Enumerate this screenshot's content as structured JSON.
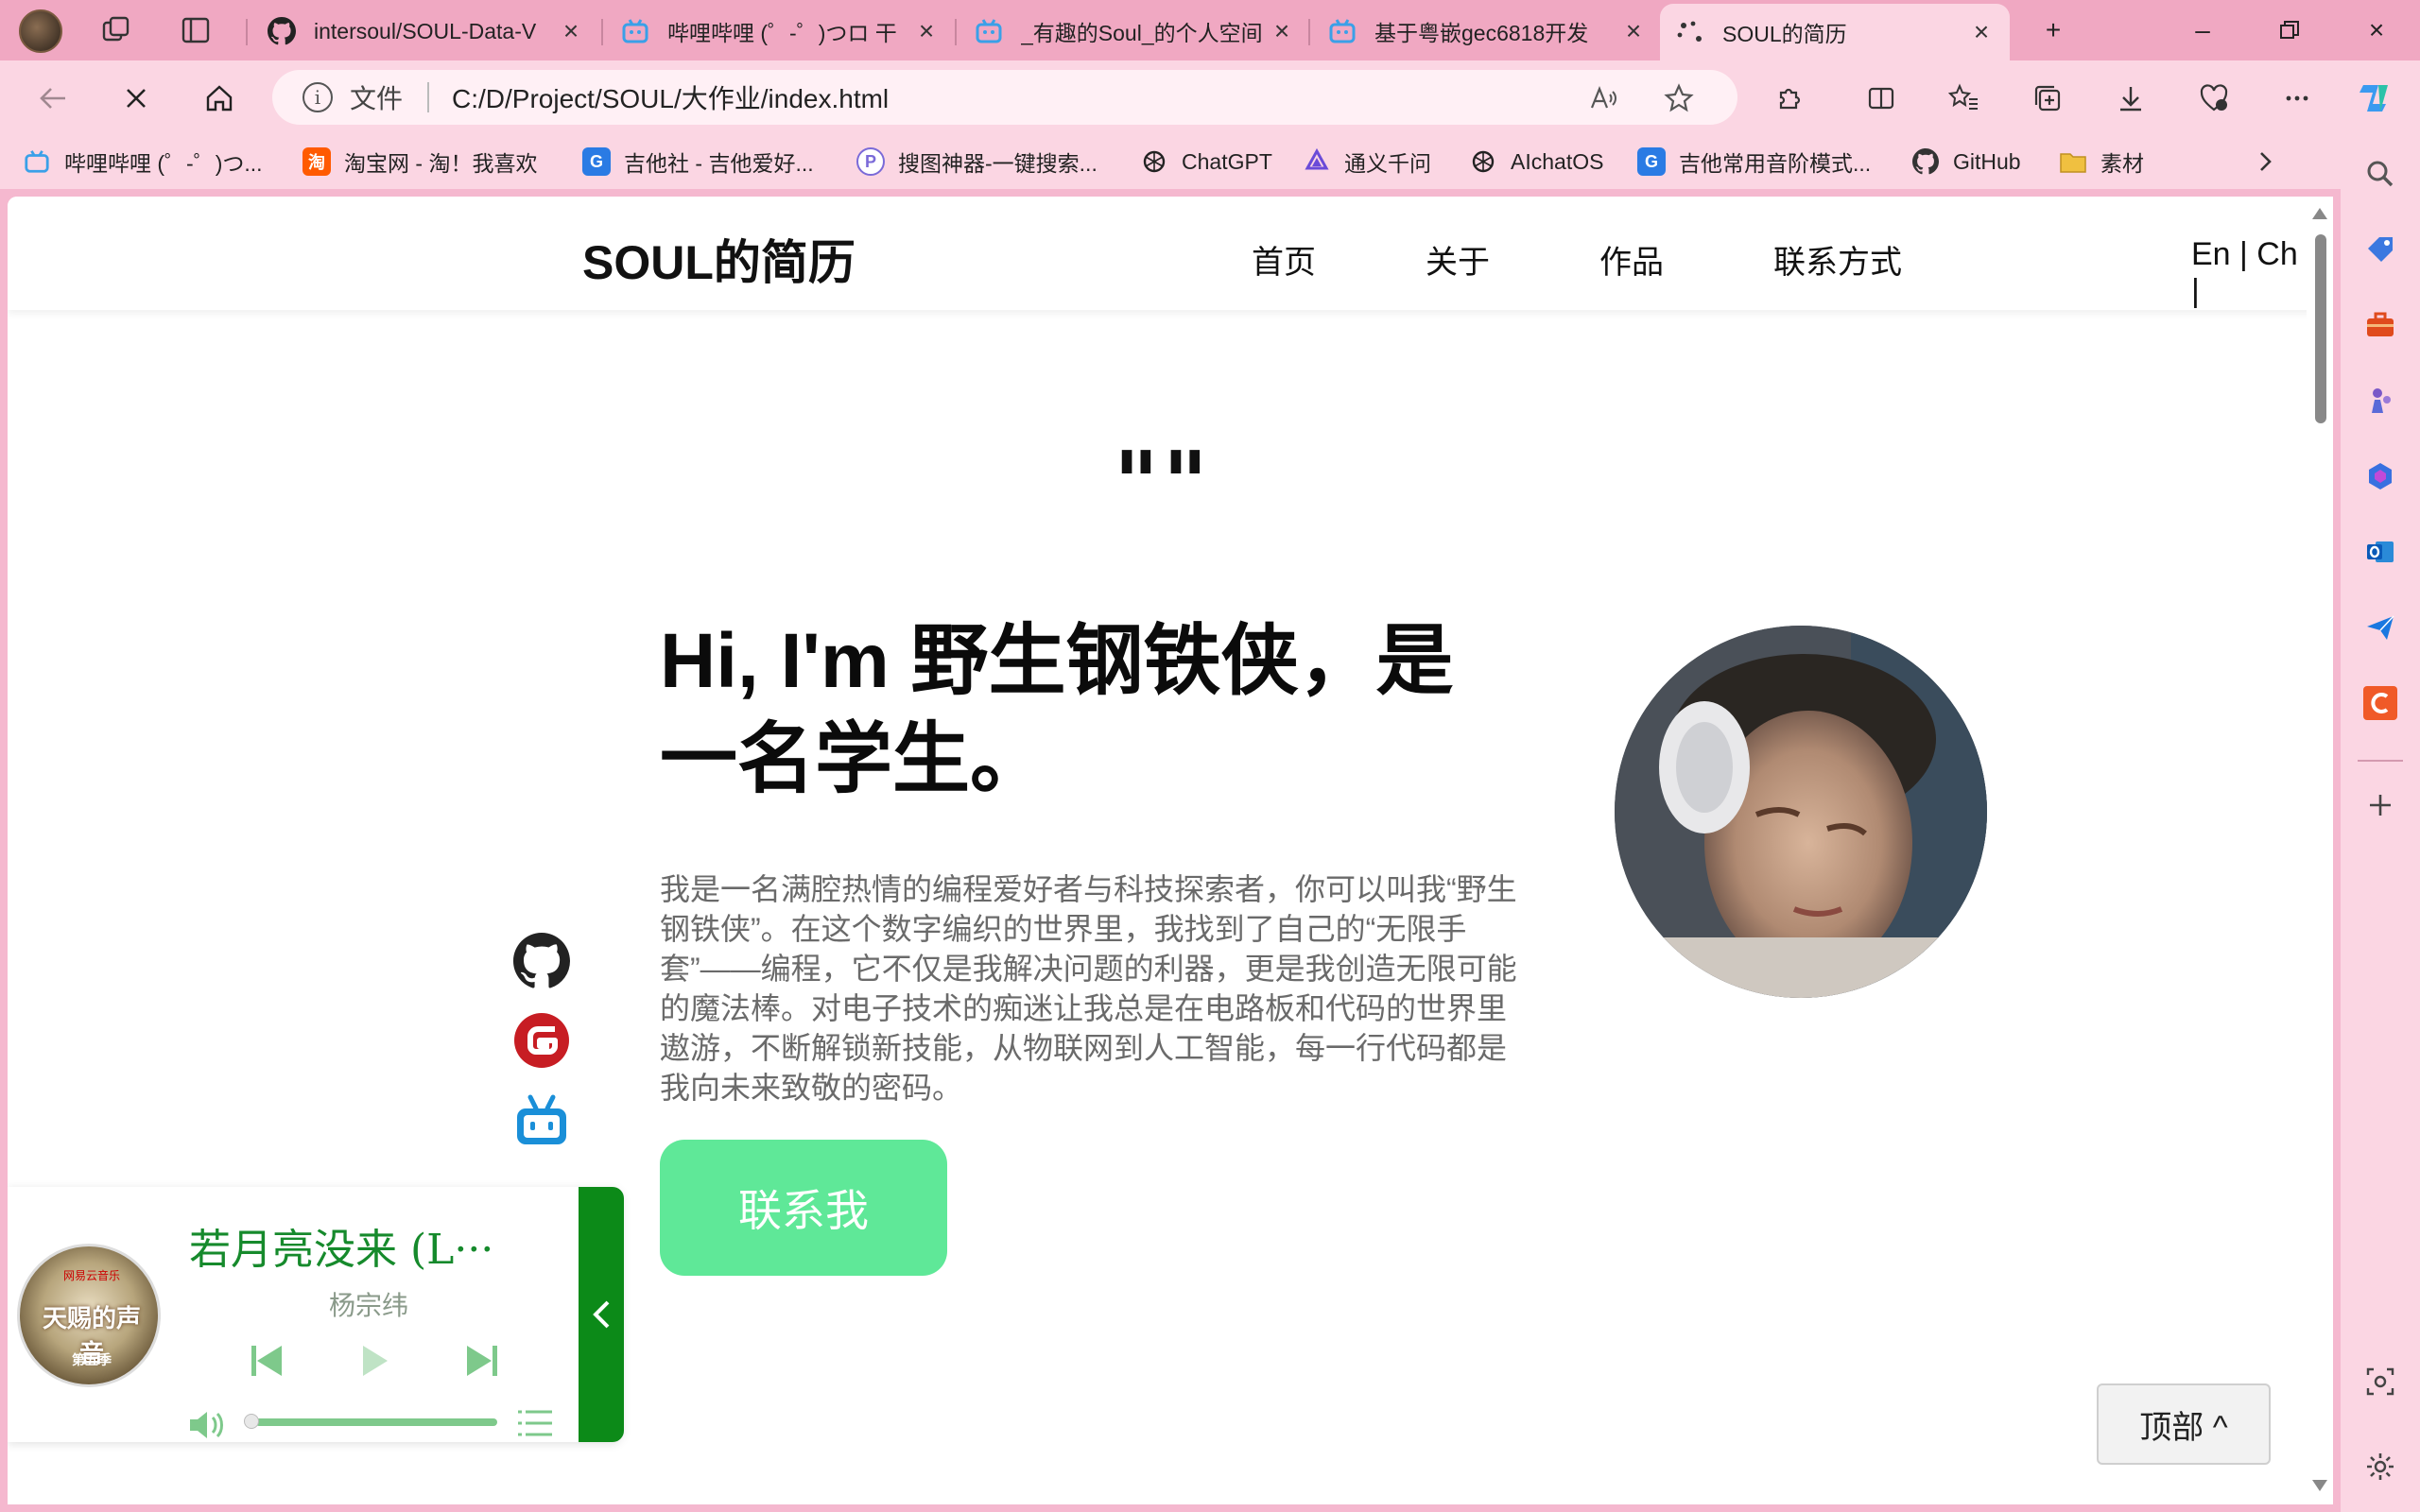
{
  "browser": {
    "tabs": [
      {
        "title": "intersoul/SOUL-Data-V",
        "icon": "github-icon"
      },
      {
        "title": "哔哩哔哩 (゜-゜)つロ 干",
        "icon": "bilibili-icon"
      },
      {
        "title": "_有趣的Soul_的个人空间",
        "icon": "bilibili-icon"
      },
      {
        "title": "基于粤嵌gec6818开发",
        "icon": "bilibili-icon"
      },
      {
        "title": "SOUL的简历",
        "icon": "loading-icon",
        "active": true
      }
    ],
    "address": {
      "scheme_label": "文件",
      "url": "C:/D/Project/SOUL/大作业/index.html"
    },
    "bookmarks": [
      {
        "label": "哔哩哔哩 (゜-゜)つ...",
        "icon": "bilibili-icon",
        "color": "#3aa0e8"
      },
      {
        "label": "淘宝网 - 淘！我喜欢",
        "icon": "taobao-icon",
        "color": "#ff5a00"
      },
      {
        "label": "吉他社 - 吉他爱好...",
        "icon": "g-icon",
        "color": "#2a7be4"
      },
      {
        "label": "搜图神器-一键搜索...",
        "icon": "search-p-icon",
        "color": "#7a6ad8"
      },
      {
        "label": "ChatGPT",
        "icon": "openai-icon",
        "color": "#222222"
      },
      {
        "label": "通义千问",
        "icon": "tongyi-icon",
        "color": "#6a4bd8"
      },
      {
        "label": "AIchatOS",
        "icon": "openai-icon",
        "color": "#222222"
      },
      {
        "label": "吉他常用音阶模式...",
        "icon": "g-icon",
        "color": "#2a7be4"
      },
      {
        "label": "GitHub",
        "icon": "github-icon",
        "color": "#333333"
      },
      {
        "label": "素材",
        "icon": "folder-icon",
        "color": "#f0c040"
      }
    ]
  },
  "site": {
    "brand": "SOUL的简历",
    "nav": [
      "首页",
      "关于",
      "作品",
      "联系方式"
    ],
    "lang": "En | Ch |",
    "quote": "\"\"",
    "hero_title": "Hi, I'm 野生钢铁侠，是一名学生。",
    "hero_desc": "我是一名满腔热情的编程爱好者与科技探索者，你可以叫我“野生钢铁侠”。在这个数字编织的世界里，我找到了自己的“无限手套”——编程，它不仅是我解决问题的利器，更是我创造无限可能的魔法棒。对电子技术的痴迷让我总是在电路板和代码的世界里遨游，不断解锁新技能，从物联网到人工智能，每一行代码都是我向未来致敬的密码。",
    "contact_button": "联系我",
    "top_button": "顶部 ^",
    "social": [
      "github-icon",
      "gitee-icon",
      "bilibili-icon"
    ]
  },
  "player": {
    "cover_text": "天赐的声音",
    "cover_top": "网易云音乐",
    "cover_bottom": "第五季",
    "song": "若月亮没来 (L···",
    "artist": "杨宗纬",
    "volume": 0.0
  },
  "colors": {
    "accent_green": "#5fe898",
    "player_green": "#0c8a18",
    "browser_pink": "#f0a8c2"
  }
}
